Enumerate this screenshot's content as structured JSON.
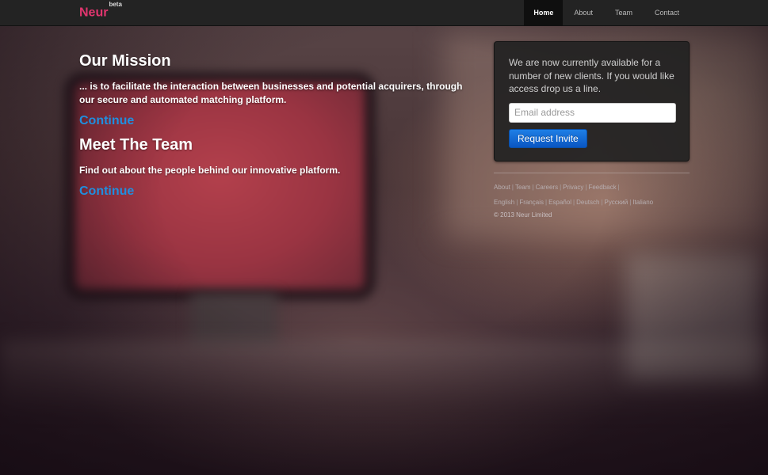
{
  "navbar": {
    "brand": "Neur",
    "brand_badge": "beta",
    "brand_color": "#e0356e",
    "items": [
      {
        "label": "Home",
        "active": true
      },
      {
        "label": "About",
        "active": false
      },
      {
        "label": "Team",
        "active": false
      },
      {
        "label": "Contact",
        "active": false
      }
    ]
  },
  "main": {
    "mission": {
      "title": "Our Mission",
      "text": "... is to facilitate the interaction between businesses and potential acquirers, through our secure and automated matching platform.",
      "link": "Continue"
    },
    "team": {
      "title": "Meet The Team",
      "text": "Find out about the people behind our innovative platform.",
      "link": "Continue"
    },
    "link_color": "#1f8fe0"
  },
  "invite": {
    "text": "We are now currently available for a number of new clients. If you would like access drop us a line.",
    "email_placeholder": "Email address",
    "button_label": "Request Invite",
    "button_color": "#0a56c2"
  },
  "footer": {
    "links": [
      "About",
      "Team",
      "Careers",
      "Privacy",
      "Feedback"
    ],
    "languages": [
      "English",
      "Français",
      "Español",
      "Deutsch",
      "Русский",
      "Italiano"
    ],
    "copyright": "© 2013 Neur Limited"
  }
}
